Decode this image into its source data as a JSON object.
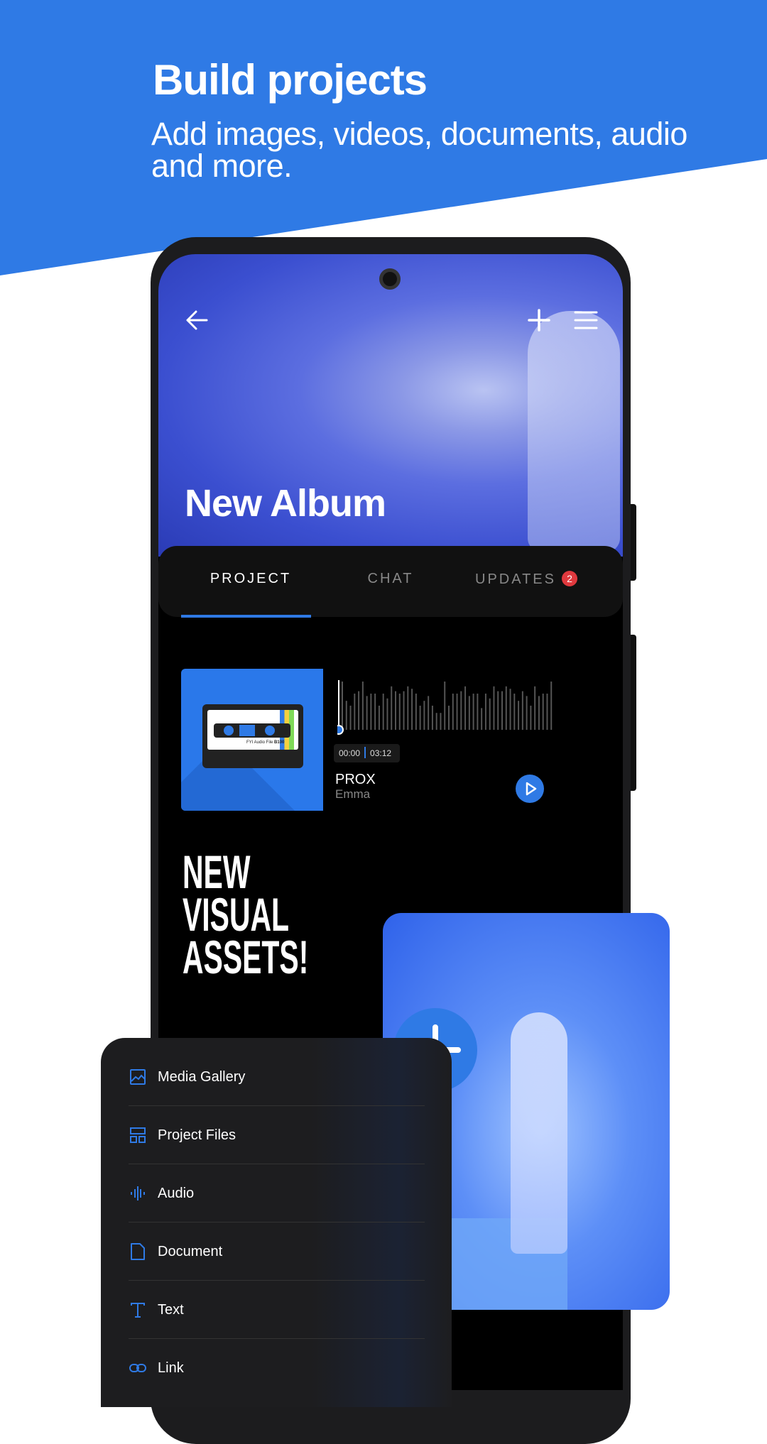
{
  "header": {
    "title": "Build projects",
    "subtitle": "Add images, videos, documents, audio and more."
  },
  "app": {
    "album_title": "New Album",
    "tabs": [
      {
        "label": "PROJECT",
        "active": true
      },
      {
        "label": "CHAT",
        "active": false
      },
      {
        "label": "UPDATES",
        "active": false,
        "badge": "2"
      }
    ],
    "audio": {
      "title": "PROX",
      "artist": "Emma",
      "current_time": "00:00",
      "duration": "03:12",
      "progress": 0,
      "cassette_label": "FYI Audio File",
      "cassette_code": "B100"
    },
    "headline": [
      "NEW",
      "VISUAL",
      "ASSETS!"
    ]
  },
  "menu": {
    "items": [
      {
        "label": "Media Gallery",
        "icon": "image-icon"
      },
      {
        "label": "Project Files",
        "icon": "layout-icon"
      },
      {
        "label": "Audio",
        "icon": "waveform-icon"
      },
      {
        "label": "Document",
        "icon": "document-icon"
      },
      {
        "label": "Text",
        "icon": "text-icon"
      },
      {
        "label": "Link",
        "icon": "link-icon"
      }
    ]
  },
  "colors": {
    "brand": "#2f7ae5",
    "badge": "#e0393e",
    "menu_bg": "#1d1d1f"
  }
}
